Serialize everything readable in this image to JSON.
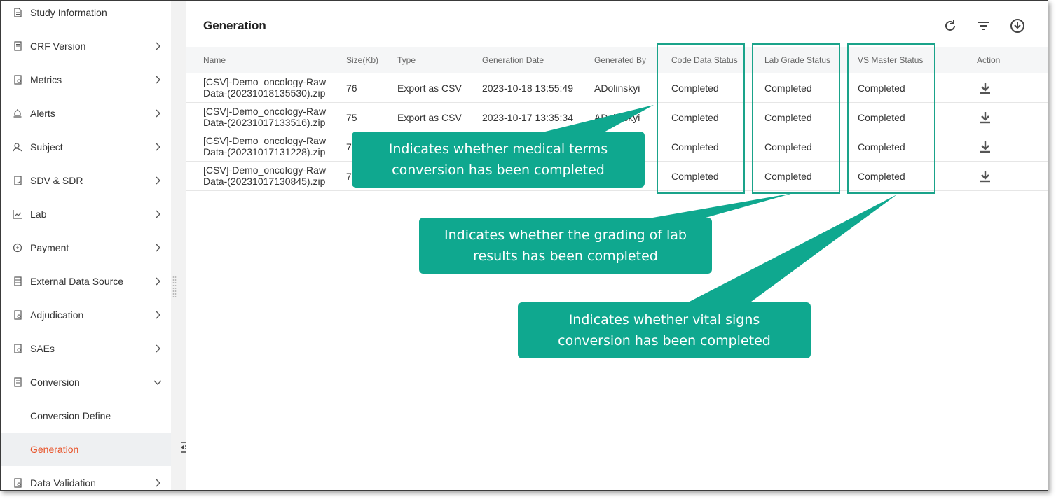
{
  "sidebar": {
    "items": [
      {
        "label": "Study Information",
        "icon": "document-icon",
        "chevron": false
      },
      {
        "label": "CRF Version",
        "icon": "list-document-icon",
        "chevron": true
      },
      {
        "label": "Metrics",
        "icon": "metrics-document-icon",
        "chevron": true
      },
      {
        "label": "Alerts",
        "icon": "bell-icon",
        "chevron": true
      },
      {
        "label": "Subject",
        "icon": "person-icon",
        "chevron": true
      },
      {
        "label": "SDV & SDR",
        "icon": "verify-document-icon",
        "chevron": true
      },
      {
        "label": "Lab",
        "icon": "line-chart-icon",
        "chevron": true
      },
      {
        "label": "Payment",
        "icon": "coin-icon",
        "chevron": true
      },
      {
        "label": "External Data Source",
        "icon": "database-icon",
        "chevron": true
      },
      {
        "label": "Adjudication",
        "icon": "review-document-icon",
        "chevron": true
      },
      {
        "label": "SAEs",
        "icon": "report-document-icon",
        "chevron": true
      },
      {
        "label": "Conversion",
        "icon": "convert-document-icon",
        "chevron": "down"
      }
    ],
    "sub_items": [
      {
        "label": "Conversion Define"
      },
      {
        "label": "Generation",
        "active": true
      }
    ],
    "last_item": {
      "label": "Data Validation",
      "icon": "validate-document-icon"
    },
    "active_color": "#e8542a"
  },
  "main": {
    "title": "Generation",
    "toolbar": [
      "refresh-icon",
      "filter-icon",
      "download-circle-icon"
    ]
  },
  "table": {
    "headers": [
      "Name",
      "Size(Kb)",
      "Type",
      "Generation Date",
      "Generated By",
      "Code Data Status",
      "Lab Grade Status",
      "VS Master Status",
      "Action"
    ],
    "rows": [
      {
        "name1": "[CSV]-Demo_oncology-Raw",
        "name2": "Data-(20231018135530).zip",
        "size": "76",
        "type": "Export as CSV",
        "date": "2023-10-18 13:55:49",
        "by": "ADolinskyi",
        "code": "Completed",
        "lab": "Completed",
        "vs": "Completed"
      },
      {
        "name1": "[CSV]-Demo_oncology-Raw",
        "name2": "Data-(20231017133516).zip",
        "size": "75",
        "type": "Export as CSV",
        "date": "2023-10-17 13:35:34",
        "by": "ADolinskyi",
        "code": "Completed",
        "lab": "Completed",
        "vs": "Completed"
      },
      {
        "name1": "[CSV]-Demo_oncology-Raw",
        "name2": "Data-(20231017131228).zip",
        "size": "7",
        "type": "",
        "date": "",
        "by": "",
        "code": "Completed",
        "lab": "Completed",
        "vs": "Completed"
      },
      {
        "name1": "[CSV]-Demo_oncology-Raw",
        "name2": "Data-(20231017130845).zip",
        "size": "7",
        "type": "",
        "date": "",
        "by": "",
        "code": "Completed",
        "lab": "Completed",
        "vs": "Completed"
      }
    ]
  },
  "callouts": {
    "code": "Indicates whether medical terms conversion has been completed",
    "lab": "Indicates whether the grading of lab results has been completed",
    "vs": "Indicates whether vital signs conversion has been completed"
  },
  "colors": {
    "callout": "#0fa88f",
    "highlight": "#1aa38a"
  }
}
